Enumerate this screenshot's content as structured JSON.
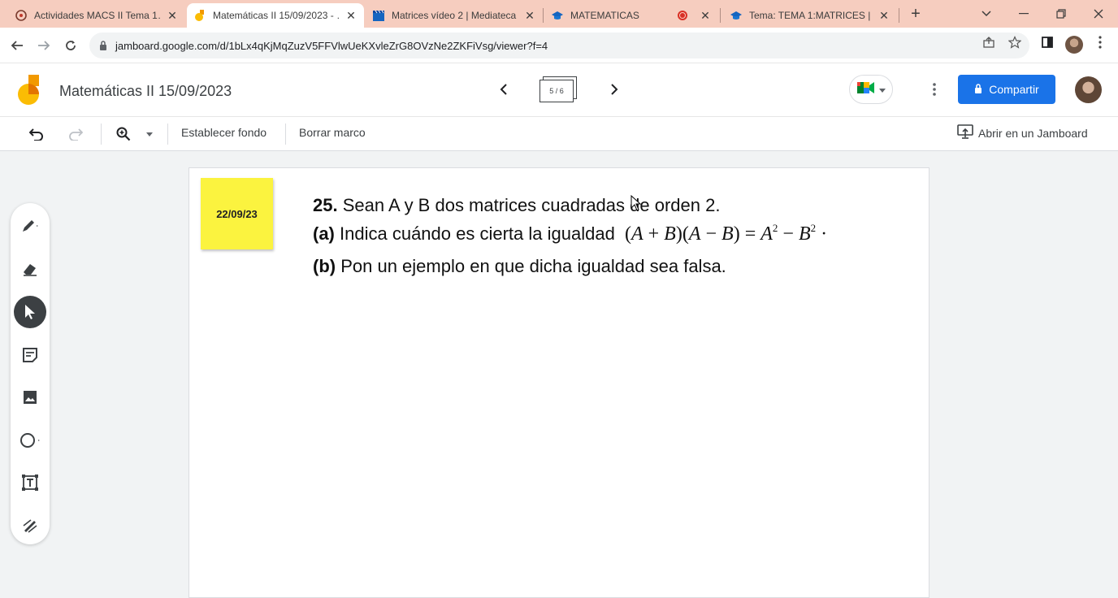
{
  "browser": {
    "tabs": [
      {
        "title": "Actividades MACS II Tema 1…",
        "icon": "course-icon",
        "active": false
      },
      {
        "title": "Matemáticas II 15/09/2023 - …",
        "icon": "jamboard-icon",
        "active": true
      },
      {
        "title": "Matrices vídeo 2 | Mediateca",
        "icon": "clapper-icon",
        "active": false
      },
      {
        "title": "MATEMATICAS",
        "icon": "classroom-cap-icon",
        "active": false
      },
      {
        "title": "Tema: TEMA 1:MATRICES | 2…",
        "icon": "classroom-cap-icon",
        "active": false
      }
    ],
    "new_tab": "+",
    "url": "jamboard.google.com/d/1bLx4qKjMqZuzV5FFVlwUeKXvleZrG8OVzNe2ZKFiVsg/viewer?f=4"
  },
  "header": {
    "title": "Matemáticas II 15/09/2023",
    "frame_indicator": "5 / 6",
    "share_label": "Compartir"
  },
  "toolbar": {
    "set_background": "Establecer fondo",
    "clear_frame": "Borrar marco",
    "open_in_jamboard": "Abrir en un Jamboard"
  },
  "canvas": {
    "sticky_note": "22/09/23",
    "problem": {
      "number": "25.",
      "intro": "Sean A y B dos matrices cuadradas de orden 2.",
      "part_a_label": "(a)",
      "part_a_text": "Indica cuándo es cierta la igualdad",
      "part_b_label": "(b)",
      "part_b_text": "Pon un ejemplo en que dicha igualdad sea falsa."
    }
  },
  "colors": {
    "tab_strip": "#f6cdbf",
    "accent_blue": "#1a73e8",
    "sticky_yellow": "#fbf33f",
    "canvas_bg": "#f1f3f4"
  }
}
